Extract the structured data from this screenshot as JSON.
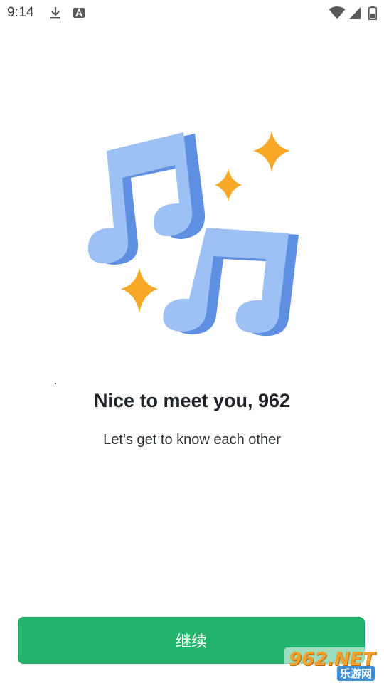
{
  "status_bar": {
    "time": "9:14",
    "icons": [
      "download-icon",
      "text-a-icon",
      "wifi-icon",
      "signal-icon",
      "battery-icon"
    ]
  },
  "illustration": {
    "name": "music-notes-with-sparkles",
    "colors": {
      "note_fill": "#9dc1f5",
      "note_shade": "#5e8fe0",
      "sparkle": "#f7a826"
    }
  },
  "main": {
    "headline": "Nice to meet you, 962",
    "subline": "Let’s get to know each other"
  },
  "footer": {
    "continue_label": "继续",
    "button_color": "#22b46c"
  },
  "watermark": {
    "brand": "962.NET",
    "sub": "乐游网"
  }
}
